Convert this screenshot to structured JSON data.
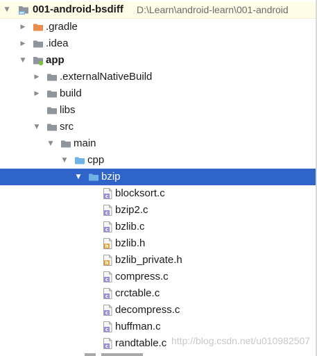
{
  "colors": {
    "selection": "#2f65ca",
    "root_highlight": "#fdfde8",
    "folder_gray": "#8f959c",
    "folder_orange": "#e98c4c",
    "folder_blue": "#6fb2e6",
    "c_file_accent": "#9c8fd6",
    "h_file_accent": "#e3a53b"
  },
  "project": {
    "name": "001-android-bsdiff",
    "path": "D:\\Learn\\android-learn\\001-android"
  },
  "tree": {
    "gradle": ".gradle",
    "idea": ".idea",
    "app": "app",
    "external_native_build": ".externalNativeBuild",
    "build": "build",
    "libs": "libs",
    "src": "src",
    "main": "main",
    "cpp": "cpp",
    "bzip": "bzip",
    "files": [
      {
        "name": "blocksort.c",
        "icon": "c-file-icon"
      },
      {
        "name": "bzip2.c",
        "icon": "c-file-icon"
      },
      {
        "name": "bzlib.c",
        "icon": "c-file-icon"
      },
      {
        "name": "bzlib.h",
        "icon": "h-file-icon"
      },
      {
        "name": "bzlib_private.h",
        "icon": "h-file-icon"
      },
      {
        "name": "compress.c",
        "icon": "c-file-icon"
      },
      {
        "name": "crctable.c",
        "icon": "c-file-icon"
      },
      {
        "name": "decompress.c",
        "icon": "c-file-icon"
      },
      {
        "name": "huffman.c",
        "icon": "c-file-icon"
      },
      {
        "name": "randtable.c",
        "icon": "c-file-icon"
      }
    ]
  },
  "watermark": "http://blog.csdn.net/u010982507"
}
